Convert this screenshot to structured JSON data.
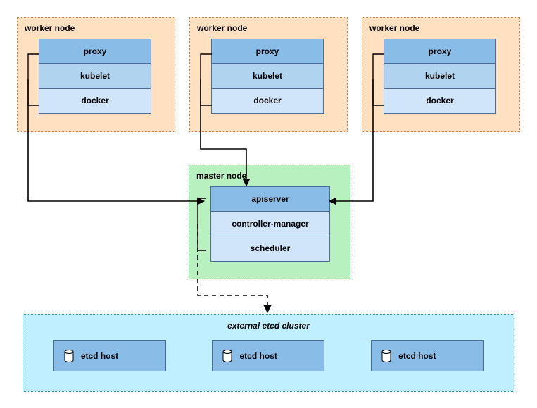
{
  "workers": [
    {
      "title": "worker node",
      "proxy": "proxy",
      "kubelet": "kubelet",
      "docker": "docker"
    },
    {
      "title": "worker node",
      "proxy": "proxy",
      "kubelet": "kubelet",
      "docker": "docker"
    },
    {
      "title": "worker node",
      "proxy": "proxy",
      "kubelet": "kubelet",
      "docker": "docker"
    }
  ],
  "master": {
    "title": "master node",
    "apiserver": "apiserver",
    "controller_manager": "controller-manager",
    "scheduler": "scheduler"
  },
  "etcd": {
    "title": "external etcd cluster",
    "host_label": "etcd host"
  },
  "colors": {
    "worker_bg": "#ffe0c0",
    "master_bg": "#b8f0c0",
    "etcd_bg": "#c0f0ff",
    "box_blue_dark": "#89bde8",
    "box_blue_mid": "#b0d4f0",
    "box_blue_light": "#d0e4fa"
  }
}
